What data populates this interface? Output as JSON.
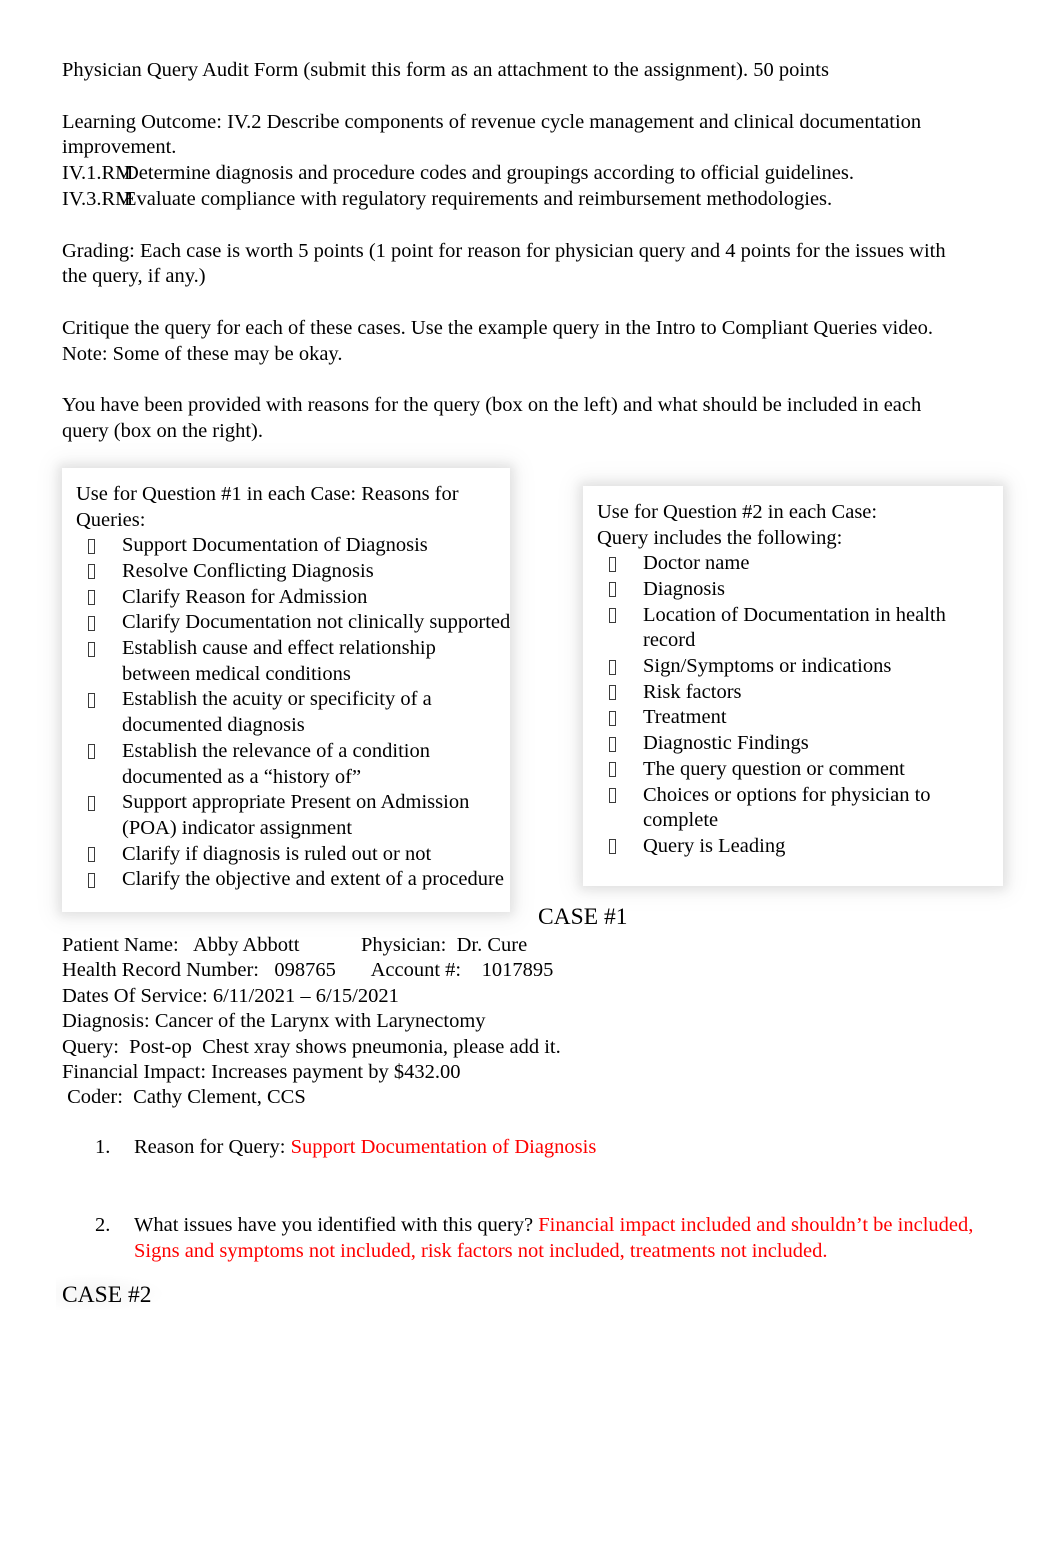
{
  "document": {
    "header_line": "Physician Query Audit Form (submit this form as an attachment to the assignment).    50 points",
    "learning_outcome_intro": "Learning Outcome:  IV.2 Describe components of revenue cycle management and clinical documentation",
    "learning_outcome_cont": "improvement.",
    "outcomes": [
      {
        "code": "IV.1.RM",
        "text": "Determine diagnosis and procedure codes and groupings according to official guidelines."
      },
      {
        "code": "IV.3.RM",
        "text": "Evaluate compliance with regulatory requirements and reimbursement methodologies."
      }
    ],
    "grading_line1": "Grading:  Each case is worth 5 points  (1 point for reason for physician query and 4 points for the issues with",
    "grading_line2": "the query, if any.)",
    "critique_line1": "Critique the query for each of these cases.    Use the example query in the Intro to Compliant Queries   video.",
    "critique_line2": "Note: Some of these may be okay.",
    "provided_line1": "You have been provided with reasons for the query (box on the left) and what should be included in each",
    "provided_line2": "query (box on the right)."
  },
  "left_box": {
    "title_line1": "Use for Question #1 in each Case: Reasons for",
    "title_line2": "Queries:",
    "items": [
      "Support Documentation of Diagnosis",
      "Resolve Conflicting Diagnosis",
      "Clarify Reason for Admission",
      "Clarify Documentation not clinically supported",
      "Establish cause and effect relationship between medical conditions",
      "Establish the acuity or specificity of a documented diagnosis",
      "Establish the relevance of a condition documented as a “history of”",
      "Support appropriate Present on Admission (POA) indicator assignment",
      "Clarify if diagnosis is ruled out or not",
      "Clarify the objective and extent of a procedure"
    ]
  },
  "right_box": {
    "title_line1": "Use for Question #2 in each Case:",
    "title_line2": "Query includes the following:",
    "items": [
      "Doctor name",
      "Diagnosis",
      "Location of Documentation in health record",
      "Sign/Symptoms or indications",
      "Risk factors",
      "Treatment",
      "Diagnostic Findings",
      "The query question or comment",
      "Choices or options for physician to complete",
      "Query is Leading"
    ]
  },
  "case1": {
    "heading": "CASE #1",
    "details": [
      "Patient Name:   Abby Abbott            Physician:  Dr. Cure",
      "Health Record Number:   098765       Account #:    1017895",
      "Dates Of Service: 6/11/2021 – 6/15/2021",
      "Diagnosis: Cancer of the Larynx with Larynectomy",
      "Query:  Post-op  Chest xray shows pneumonia, please add it.",
      "Financial Impact: Increases payment by $432.00",
      " Coder:  Cathy Clement, CCS"
    ],
    "questions": [
      {
        "number": "1.",
        "prompt": "Reason for Query:  ",
        "answer": "Support Documentation of Diagnosis"
      },
      {
        "number": "2.",
        "prompt": "What issues have you identified with this query? ",
        "answer": "Financial impact included and shouldn’t be included, Signs and symptoms not included, risk factors not included, treatments not included."
      }
    ]
  },
  "case2": {
    "heading": "CASE #2"
  },
  "colors": {
    "answer_red": "#FF0000",
    "text_black": "#000000",
    "page_background": "#FFFFFF"
  }
}
